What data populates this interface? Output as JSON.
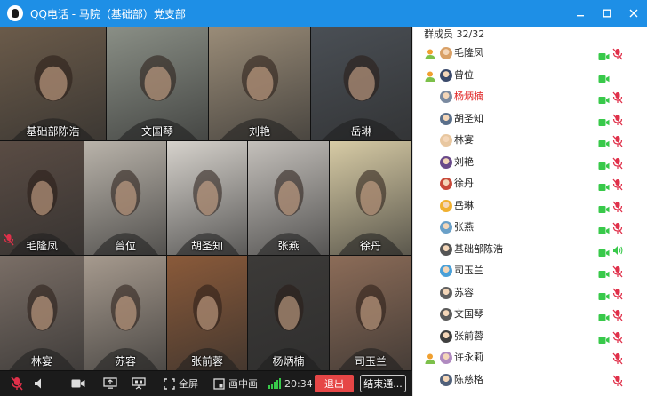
{
  "window": {
    "title": "QQ电话 - 马院（基础部）党支部"
  },
  "colors": {
    "titlebar": "#1e8fe6",
    "exit": "#e64646",
    "mute_red": "#e0304a",
    "cam_green": "#38c94a",
    "speaking_name": "#e02020"
  },
  "tiles": [
    {
      "name": "基础部陈浩",
      "bg": "#6b5b4a",
      "muted": false
    },
    {
      "name": "文国琴",
      "bg": "#8a8f86",
      "muted": false
    },
    {
      "name": "刘艳",
      "bg": "#9a8c78",
      "muted": false
    },
    {
      "name": "岳琳",
      "bg": "#4a4f55",
      "muted": false
    },
    {
      "name": "毛隆凤",
      "bg": "#5a4c44",
      "muted": true
    },
    {
      "name": "曾位",
      "bg": "#b9b3aa",
      "muted": false
    },
    {
      "name": "胡圣知",
      "bg": "#d6d2cc",
      "muted": false
    },
    {
      "name": "张燕",
      "bg": "#c4c0bb",
      "muted": false
    },
    {
      "name": "徐丹",
      "bg": "#d7cba5",
      "muted": false
    },
    {
      "name": "林宴",
      "bg": "#7a6e66",
      "muted": false
    },
    {
      "name": "苏容",
      "bg": "#a69a8e",
      "muted": false
    },
    {
      "name": "张前蓉",
      "bg": "#8a5a3a",
      "muted": false
    },
    {
      "name": "杨炳楠",
      "bg": "#3c3a38",
      "muted": false
    },
    {
      "name": "司玉兰",
      "bg": "#8c6c58",
      "muted": false
    }
  ],
  "toolbar": {
    "fullscreen_label": "全屏",
    "pip_label": "画中画",
    "timer": "20:34",
    "exit_label": "退出",
    "end_label": "结束通..."
  },
  "panel": {
    "header": "群成员 32/32"
  },
  "members": [
    {
      "name": "毛隆凤",
      "admin": true,
      "camera": true,
      "mic": "muted",
      "avatar": "#d9a066",
      "highlight": false
    },
    {
      "name": "曾位",
      "admin": true,
      "camera": true,
      "mic": "none",
      "avatar": "#3b4a6b",
      "highlight": false
    },
    {
      "name": "杨炳楠",
      "admin": false,
      "camera": true,
      "mic": "muted",
      "avatar": "#7a8aa0",
      "highlight": true
    },
    {
      "name": "胡圣知",
      "admin": false,
      "camera": true,
      "mic": "muted",
      "avatar": "#5a6f8a",
      "highlight": false
    },
    {
      "name": "林宴",
      "admin": false,
      "camera": true,
      "mic": "muted",
      "avatar": "#e8c7a0",
      "highlight": false
    },
    {
      "name": "刘艳",
      "admin": false,
      "camera": true,
      "mic": "muted",
      "avatar": "#6a4a8a",
      "highlight": false
    },
    {
      "name": "徐丹",
      "admin": false,
      "camera": true,
      "mic": "muted",
      "avatar": "#c84a3a",
      "highlight": false
    },
    {
      "name": "岳琳",
      "admin": false,
      "camera": true,
      "mic": "muted",
      "avatar": "#f0b030",
      "highlight": false
    },
    {
      "name": "张燕",
      "admin": false,
      "camera": true,
      "mic": "muted",
      "avatar": "#6aa0c8",
      "highlight": false
    },
    {
      "name": "基础部陈浩",
      "admin": false,
      "camera": true,
      "mic": "speaking",
      "avatar": "#555555",
      "highlight": false
    },
    {
      "name": "司玉兰",
      "admin": false,
      "camera": true,
      "mic": "muted",
      "avatar": "#4aa0d8",
      "highlight": false
    },
    {
      "name": "苏容",
      "admin": false,
      "camera": true,
      "mic": "muted",
      "avatar": "#606060",
      "highlight": false
    },
    {
      "name": "文国琴",
      "admin": false,
      "camera": true,
      "mic": "muted",
      "avatar": "#5a5a5a",
      "highlight": false
    },
    {
      "name": "张前蓉",
      "admin": false,
      "camera": true,
      "mic": "muted",
      "avatar": "#404040",
      "highlight": false
    },
    {
      "name": "许永莉",
      "admin": true,
      "camera": false,
      "mic": "muted",
      "avatar": "#b08ac0",
      "highlight": false
    },
    {
      "name": "陈慈格",
      "admin": false,
      "camera": false,
      "mic": "muted",
      "avatar": "#50607a",
      "highlight": false
    }
  ]
}
